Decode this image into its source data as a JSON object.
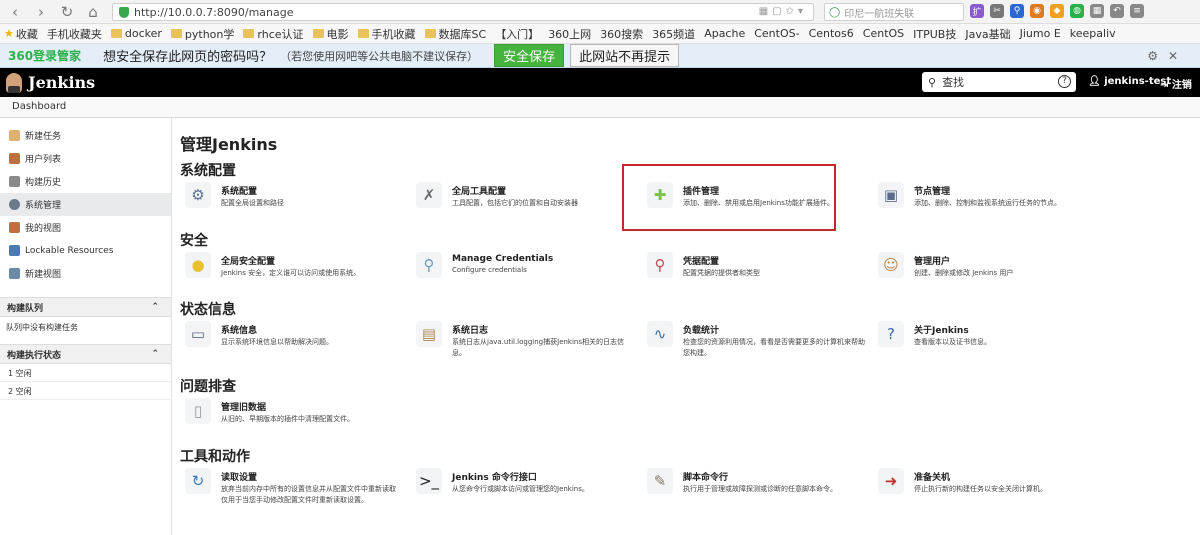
{
  "browser": {
    "url": "http://10.0.0.7:8090/manage",
    "search_placeholder": "印尼一航班失联",
    "bookmarks": [
      "收藏",
      "手机收藏夹",
      "docker",
      "python学",
      "rhce认证",
      "电影",
      "手机收藏",
      "数据库SC",
      "【入门】",
      "360上网",
      "360搜索",
      "365频道",
      "Apache",
      "CentOS-",
      "Centos6",
      "CentOS",
      "ITPUB技",
      "Java基础",
      "Jiumo E",
      "keepaliv"
    ]
  },
  "pwbar": {
    "brand": "360登录管家",
    "question": "想安全保存此网页的密码吗？",
    "note": "（若您使用网吧等公共电脑不建议保存）",
    "save": "安全保存",
    "no": "此网站不再提示"
  },
  "header": {
    "logo": "Jenkins",
    "search_placeholder": "查找",
    "user": "jenkins-test",
    "logout": "注销"
  },
  "breadcrumb": "Dashboard",
  "sidebar": {
    "items": [
      {
        "label": "新建任务",
        "color": "#e0b070"
      },
      {
        "label": "用户列表",
        "color": "#c07040"
      },
      {
        "label": "构建历史",
        "color": "#8a8a8a"
      },
      {
        "label": "系统管理",
        "color": "#6a7a8a"
      },
      {
        "label": "我的视图",
        "color": "#c07040"
      },
      {
        "label": "Lockable Resources",
        "color": "#4a7ab0"
      },
      {
        "label": "新建视图",
        "color": "#6a8aa8"
      }
    ],
    "queue_title": "构建队列",
    "queue_empty": "队列中没有构建任务",
    "exec_title": "构建执行状态",
    "executors": [
      "1  空闲",
      "2  空闲"
    ]
  },
  "main": {
    "title": "管理Jenkins",
    "sections": [
      {
        "title": "系统配置",
        "items": [
          {
            "title": "系统配置",
            "desc": "配置全局设置和路径",
            "icon": "⚙",
            "color": "#5a7090"
          },
          {
            "title": "全局工具配置",
            "desc": "工具配置，包括它们的位置和自动安装器",
            "icon": "✗",
            "color": "#6a6a6a"
          },
          {
            "title": "插件管理",
            "desc": "添加、删除、禁用或启用Jenkins功能扩展插件。",
            "icon": "✚",
            "color": "#7ac04a"
          },
          {
            "title": "节点管理",
            "desc": "添加、删除、控制和监视系统运行任务的节点。",
            "icon": "▣",
            "color": "#5a6a8a"
          }
        ]
      },
      {
        "title": "安全",
        "items": [
          {
            "title": "全局安全配置",
            "desc": "Jenkins 安全，定义谁可以访问或使用系统。",
            "icon": "●",
            "color": "#e8c030"
          },
          {
            "title": "Manage Credentials",
            "desc": "Configure credentials",
            "icon": "⚲",
            "color": "#6a9ac0"
          },
          {
            "title": "凭据配置",
            "desc": "配置凭据的提供者和类型",
            "icon": "⚲",
            "color": "#c05050"
          },
          {
            "title": "管理用户",
            "desc": "创建、删除或修改 Jenkins 用户",
            "icon": "☺",
            "color": "#c08040"
          }
        ]
      },
      {
        "title": "状态信息",
        "items": [
          {
            "title": "系统信息",
            "desc": "显示系统环境信息以帮助解决问题。",
            "icon": "▭",
            "color": "#5a6a80"
          },
          {
            "title": "系统日志",
            "desc": "系统日志从java.util.logging捕获Jenkins相关的日志信息。",
            "icon": "▤",
            "color": "#b08850"
          },
          {
            "title": "负载统计",
            "desc": "检查您的资源利用情况，看看是否需要更多的计算机来帮助您构建。",
            "icon": "∿",
            "color": "#3a6a9a"
          },
          {
            "title": "关于Jenkins",
            "desc": "查看版本以及证书信息。",
            "icon": "?",
            "color": "#3a6aa8"
          }
        ]
      },
      {
        "title": "问题排查",
        "items": [
          {
            "title": "管理旧数据",
            "desc": "从旧的、早期版本的插件中清理配置文件。",
            "icon": "▯",
            "color": "#9a9a9a"
          }
        ]
      },
      {
        "title": "工具和动作",
        "items": [
          {
            "title": "读取设置",
            "desc": "放弃当前内存中所有的设置信息并从配置文件中重新读取 仅用于当您手动修改配置文件时重新读取设置。",
            "icon": "↻",
            "color": "#3a7ac0"
          },
          {
            "title": "Jenkins 命令行接口",
            "desc": "从您命令行或脚本访问或管理您的Jenkins。",
            "icon": ">_",
            "color": "#222"
          },
          {
            "title": "脚本命令行",
            "desc": "执行用于管理或故障探测或诊断的任意脚本命令。",
            "icon": "✎",
            "color": "#8a7a60"
          },
          {
            "title": "准备关机",
            "desc": "停止执行新的构建任务以安全关闭计算机。",
            "icon": "➜",
            "color": "#c03030"
          }
        ]
      }
    ]
  }
}
